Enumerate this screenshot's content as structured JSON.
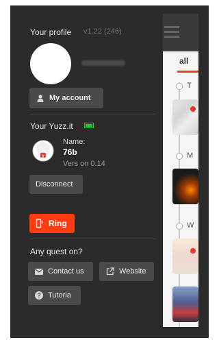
{
  "profile": {
    "title": "Your profile",
    "version": "v1.22 (246)",
    "account_button": "My account",
    "account_icon": "user-icon"
  },
  "device": {
    "section_title": "Your Yuzz.it",
    "status_color": "#25c637",
    "name_label": "Name:",
    "name": "76b",
    "version": "Vers on 0.14",
    "disconnect_button": "Disconnect",
    "ring_button": "Ring",
    "ring_color": "#ff3b0f",
    "ring_icon": "phone-ring-icon"
  },
  "help": {
    "section_title": "Any quest on?",
    "contact_button": "Contact us",
    "contact_icon": "mail-icon",
    "website_button": "Website",
    "website_icon": "external-link-icon",
    "tutorial_button": "Tutoria",
    "tutorial_icon": "help-icon"
  },
  "main": {
    "tab_label": "all",
    "accent_color": "#e33b2e",
    "timeline_letters": [
      "T",
      "M",
      "W"
    ]
  }
}
